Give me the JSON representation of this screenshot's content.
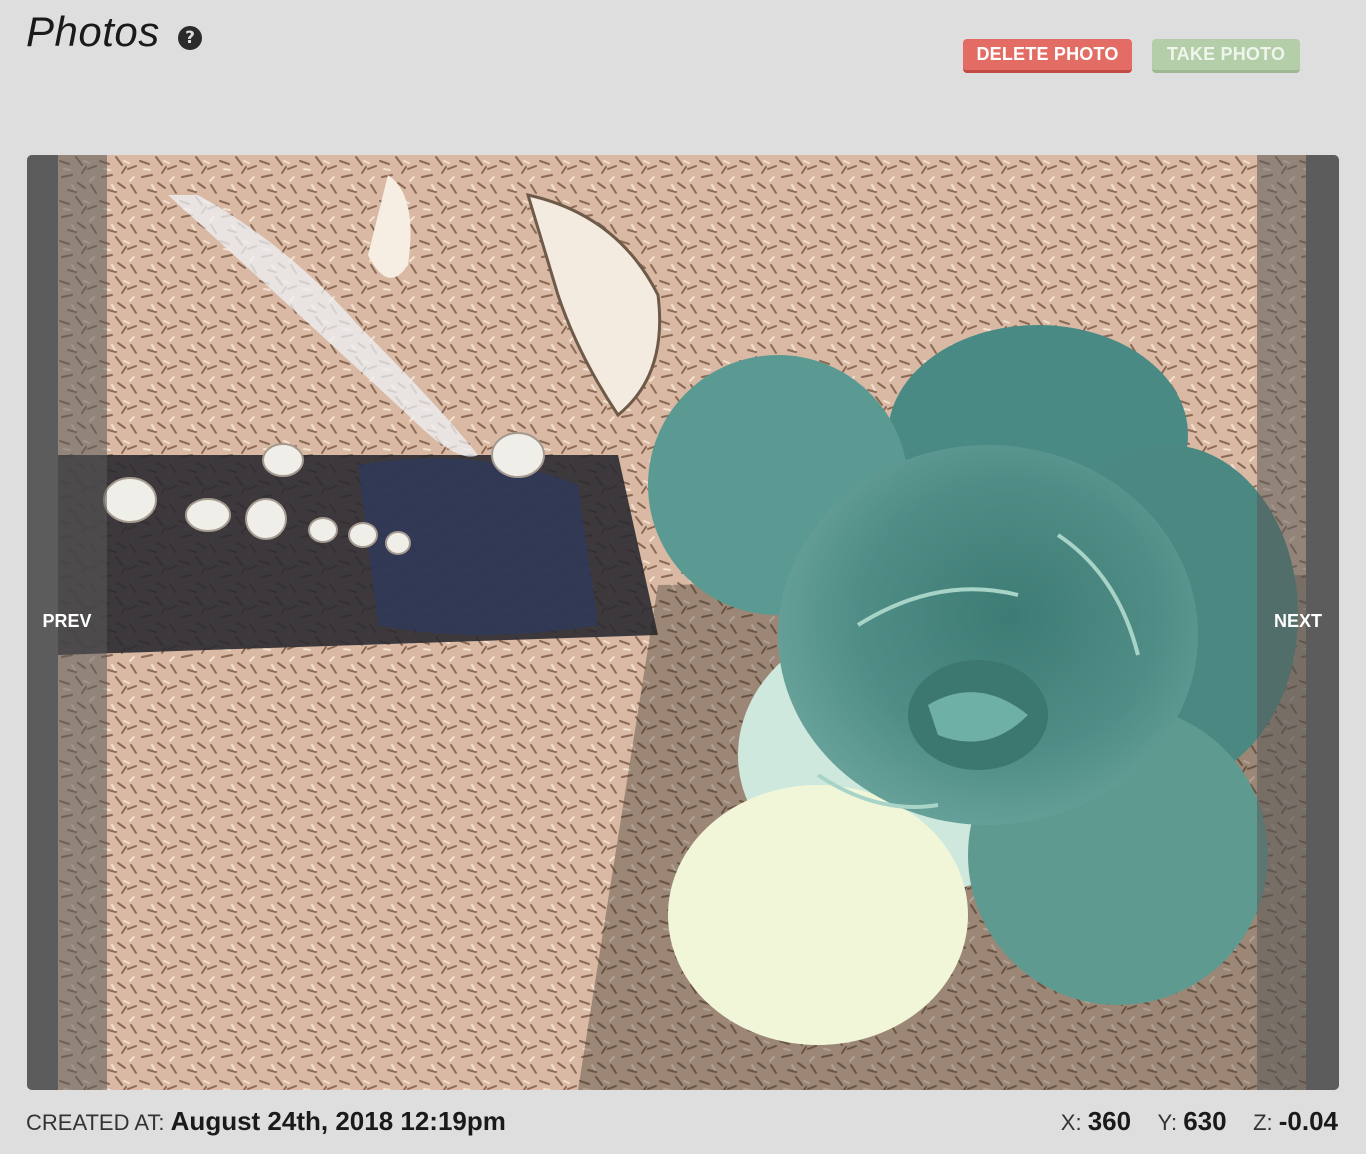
{
  "header": {
    "title": "Photos",
    "help_icon": "question-circle-icon"
  },
  "actions": {
    "delete_label": "DELETE PHOTO",
    "take_label": "TAKE PHOTO"
  },
  "viewer": {
    "prev_label": "PREV",
    "next_label": "NEXT"
  },
  "meta": {
    "created_label": "CREATED AT:",
    "created_value": "August 24th, 2018 12:19pm",
    "x_label": "X:",
    "x_value": "360",
    "y_label": "Y:",
    "y_value": "630",
    "z_label": "Z:",
    "z_value": "-0.04"
  },
  "colors": {
    "delete_button": "#e36c64",
    "take_button": "#b5ceaa",
    "nav_overlay": "#5f5f5f"
  }
}
